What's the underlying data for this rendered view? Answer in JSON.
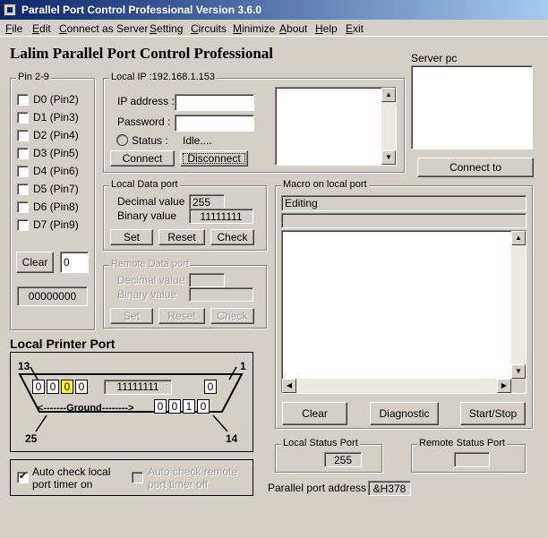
{
  "window": {
    "title": "Parallel Port Control Professional Version 3.6.0"
  },
  "menu": [
    "File",
    "Edit",
    "Connect as Server",
    "Setting",
    "Circuits",
    "Minimize",
    "About",
    "Help",
    "Exit"
  ],
  "app_title": "Lalim Parallel Port Control Professional",
  "pins": {
    "label": "Pin 2-9",
    "items": [
      "D0  (Pin2)",
      "D1  (Pin3)",
      "D2  (Pin4)",
      "D3  (Pin5)",
      "D4  (Pin6)",
      "D5  (Pin7)",
      "D6  (Pin8)",
      "D7  (Pin9)"
    ],
    "clear_label": "Clear",
    "clear_value": "0",
    "binary_readout": "00000000"
  },
  "local_ip": {
    "label": "Local IP  :192.168.1.153",
    "ip_label": "IP address :",
    "ip_value": "",
    "password_label": "Password :",
    "password_value": "",
    "status_label": "Status :",
    "status_value": "Idle....",
    "connect_label": "Connect",
    "disconnect_label": "Disconnect"
  },
  "local_data": {
    "label": "Local Data port",
    "decimal_label": "Decimal value",
    "decimal_value": "255",
    "binary_label": "Binary value",
    "binary_value": "11111111",
    "set_label": "Set",
    "reset_label": "Reset",
    "check_label": "Check"
  },
  "remote_data": {
    "label": "Remote Data port",
    "decimal_label": "Decimal value",
    "binary_label": "Binary value",
    "set_label": "Set",
    "reset_label": "Reset",
    "check_label": "Check"
  },
  "server": {
    "label": "Server pc",
    "connect_to_label": "Connect to"
  },
  "macro": {
    "label": "Macro on local port",
    "editing_label": "Editing",
    "clear_label": "Clear",
    "diagnostic_label": "Diagnostic",
    "startstop_label": "Start/Stop"
  },
  "printer": {
    "title": "Local Printer Port",
    "pin13": "13",
    "pin1": "1",
    "pin25": "25",
    "pin14": "14",
    "status_bits": [
      "0",
      "0",
      "0",
      "0"
    ],
    "highlighted_bit": 2,
    "data_bits": "11111111",
    "ack_bit": "0",
    "ground_label": "<-------Ground-------->",
    "control_bits": [
      "0",
      "0",
      "1",
      "0"
    ]
  },
  "timers": {
    "local_label": "Auto check local\nport timer on",
    "local_checked": true,
    "remote_label": "Auto check remote\nport timer off"
  },
  "status_ports": {
    "local_label": "Local Status Port",
    "local_value": "255",
    "remote_label": "Remote Status Port",
    "remote_value": ""
  },
  "address": {
    "label": "Parallel port address :",
    "value": "&H378"
  }
}
